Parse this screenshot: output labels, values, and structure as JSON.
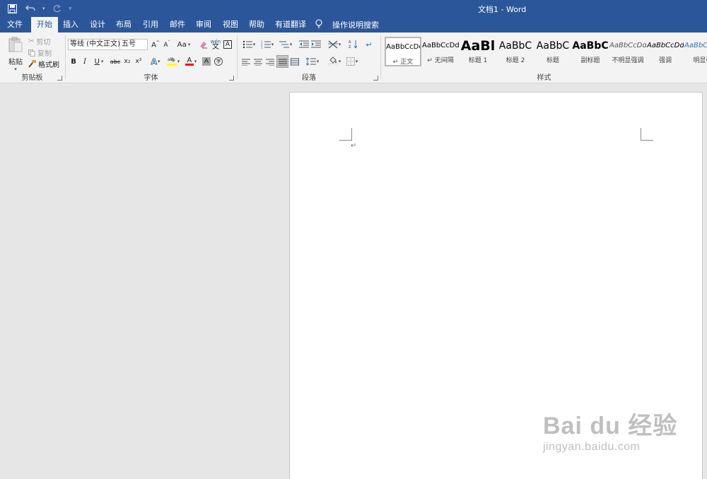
{
  "window": {
    "title": "文档1  -  Word"
  },
  "quick_access": {
    "icons": [
      "save-icon",
      "undo-icon",
      "redo-icon",
      "customize-icon"
    ]
  },
  "tabs": [
    {
      "label": "文件",
      "active": false
    },
    {
      "label": "开始",
      "active": true
    },
    {
      "label": "插入",
      "active": false
    },
    {
      "label": "设计",
      "active": false
    },
    {
      "label": "布局",
      "active": false
    },
    {
      "label": "引用",
      "active": false
    },
    {
      "label": "邮件",
      "active": false
    },
    {
      "label": "审阅",
      "active": false
    },
    {
      "label": "视图",
      "active": false
    },
    {
      "label": "帮助",
      "active": false
    },
    {
      "label": "有道翻译",
      "active": false
    }
  ],
  "tell_me": {
    "label": "操作说明搜索"
  },
  "clipboard": {
    "group_label": "剪贴板",
    "paste_label": "粘贴",
    "cut_label": "剪切",
    "copy_label": "复制",
    "format_painter_label": "格式刷"
  },
  "font": {
    "group_label": "字体",
    "font_name": "等线 (中文正文)",
    "font_size": "五号",
    "change_case_label": "Aa",
    "bold": "B",
    "italic": "I",
    "underline": "U",
    "strike": "abc",
    "subscript": "x₂",
    "superscript": "x²",
    "highlight_color": "#ffff00",
    "font_color": "#ff0000"
  },
  "paragraph": {
    "group_label": "段落"
  },
  "styles": {
    "group_label": "样式",
    "items": [
      {
        "preview": "AaBbCcDd",
        "name": "↵ 正文",
        "selected": true
      },
      {
        "preview": "AaBbCcDd",
        "name": "↵ 无间隔",
        "selected": false
      },
      {
        "preview": "AaBl",
        "name": "标题 1",
        "selected": false
      },
      {
        "preview": "AaBbC",
        "name": "标题 2",
        "selected": false
      },
      {
        "preview": "AaBbC",
        "name": "标题",
        "selected": false
      },
      {
        "preview": "AaBbC",
        "name": "副标题",
        "selected": false
      },
      {
        "preview": "AaBbCcDd",
        "name": "不明显强调",
        "selected": false
      },
      {
        "preview": "AaBbCcDd",
        "name": "强调",
        "selected": false
      },
      {
        "preview": "AaBbCcDd",
        "name": "明显强",
        "selected": false
      }
    ]
  },
  "document": {
    "paragraph_mark": "↵"
  },
  "watermark": {
    "main": "Bai du 经验",
    "sub": "jingyan.baidu.com"
  }
}
